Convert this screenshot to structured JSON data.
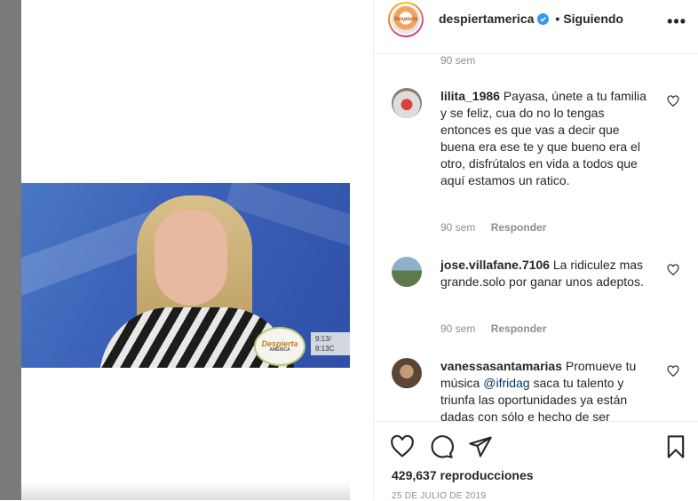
{
  "header": {
    "username": "despiertamerica",
    "separator": "•",
    "follow_status": "Siguiendo",
    "more_label": "•••",
    "avatar_logo_text": "Despierta"
  },
  "video": {
    "logo_text": "Despierta",
    "logo_sub": "AMÉRICA",
    "clock_line1": "9:13/",
    "clock_line2": "8:13C"
  },
  "comments": {
    "top_time": "90 sem",
    "items": [
      {
        "username": "lilita_1986",
        "text": "Payasa, únete a tu familia y se feliz, cua do no lo tengas entonces es que vas a decir que buena era ese te y que bueno era el otro, disfrútalos en vida a todos que aquí estamos un ratico.",
        "time": "90 sem",
        "reply": "Responder"
      },
      {
        "username": "jose.villafane.7106",
        "text": "La ridiculez mas grande.solo por ganar unos adeptos.",
        "time": "90 sem",
        "reply": "Responder"
      },
      {
        "username": "vanessasantamarias",
        "text_before": "Promueve tu música",
        "mention": "@ifridag",
        "text_after": "saca tu talento y triunfa las oportunidades ya están dadas con sólo e hecho de ser"
      }
    ]
  },
  "actions": {
    "views_count": "429,637",
    "views_label": "reproducciones",
    "date": "25 DE JULIO DE 2019"
  },
  "colors": {
    "verified": "#3897f0",
    "secondary_text": "#8e8e8e",
    "mention": "#00376b"
  }
}
